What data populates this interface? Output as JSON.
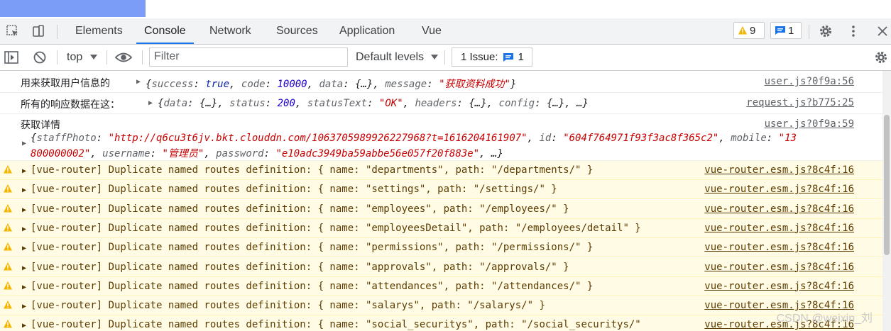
{
  "tabs": [
    "Elements",
    "Console",
    "Network",
    "Sources",
    "Application",
    "Vue"
  ],
  "active_tab": "Console",
  "badges": {
    "warnings": "9",
    "messages": "1"
  },
  "toolbar": {
    "context": "top",
    "filter_placeholder": "Filter",
    "levels": "Default levels",
    "issues_label": "1 Issue:",
    "issues_count": "1"
  },
  "logs": {
    "l1_label": "用来获取用户信息的",
    "l1_src": "user.js?0f9a:56",
    "l1_obj": {
      "open": "{",
      "k1": "success",
      "v1": "true",
      "k2": "code",
      "v2": "10000",
      "k3": "data",
      "v3": "{…}",
      "k4": "message",
      "v4": "\"获取资料成功\"",
      "close": "}"
    },
    "l2_label": "所有的响应数据在这：",
    "l2_src": "request.js?b775:25",
    "l2_obj": {
      "open": "{",
      "k1": "data",
      "v1": "{…}",
      "k2": "status",
      "v2": "200",
      "k3": "statusText",
      "v3": "\"OK\"",
      "k4": "headers",
      "v4": "{…}",
      "k5": "config",
      "v5": "{…}",
      "tail": "…}"
    },
    "l3_label": "获取详情",
    "l3_src": "user.js?0f9a:59",
    "l3_obj": {
      "k1": "staffPhoto",
      "v1": "\"http://q6cu3t6jv.bkt.clouddn.com/1063705989926227968?t=1616204161907\"",
      "k2": "id",
      "v2": "\"604f764971f93f3ac8f365c2\"",
      "k3": "mobile",
      "v3a": "\"13",
      "v3b": "800000002\"",
      "k4": "username",
      "v4": "\"管理员\"",
      "k5": "password",
      "v5": "\"e10adc3949ba59abbe56e057f20f883e\"",
      "tail": "…}"
    }
  },
  "warnings": [
    {
      "text": "[vue-router] Duplicate named routes definition: { name: \"departments\", path: \"/departments/\" }",
      "src": "vue-router.esm.js?8c4f:16"
    },
    {
      "text": "[vue-router] Duplicate named routes definition: { name: \"settings\", path: \"/settings/\" }",
      "src": "vue-router.esm.js?8c4f:16"
    },
    {
      "text": "[vue-router] Duplicate named routes definition: { name: \"employees\", path: \"/employees/\" }",
      "src": "vue-router.esm.js?8c4f:16"
    },
    {
      "text": "[vue-router] Duplicate named routes definition: { name: \"employeesDetail\", path: \"/employees/detail\" }",
      "src": "vue-router.esm.js?8c4f:16"
    },
    {
      "text": "[vue-router] Duplicate named routes definition: { name: \"permissions\", path: \"/permissions/\" }",
      "src": "vue-router.esm.js?8c4f:16"
    },
    {
      "text": "[vue-router] Duplicate named routes definition: { name: \"approvals\", path: \"/approvals/\" }",
      "src": "vue-router.esm.js?8c4f:16"
    },
    {
      "text": "[vue-router] Duplicate named routes definition: { name: \"attendances\", path: \"/attendances/\" }",
      "src": "vue-router.esm.js?8c4f:16"
    },
    {
      "text": "[vue-router] Duplicate named routes definition: { name: \"salarys\", path: \"/salarys/\" }",
      "src": "vue-router.esm.js?8c4f:16"
    },
    {
      "text": "[vue-router] Duplicate named routes definition: { name: \"social_securitys\", path: \"/social_securitys/\"",
      "src": "vue-router.esm.js?8c4f:16"
    }
  ],
  "watermark": "CSDN @weixin_刘",
  "colors": {
    "accent": "#1a73e8",
    "warning_bg": "#fffbe5",
    "warning_text": "#5c3c00",
    "string": "#c80000",
    "number": "#1c00cf"
  }
}
